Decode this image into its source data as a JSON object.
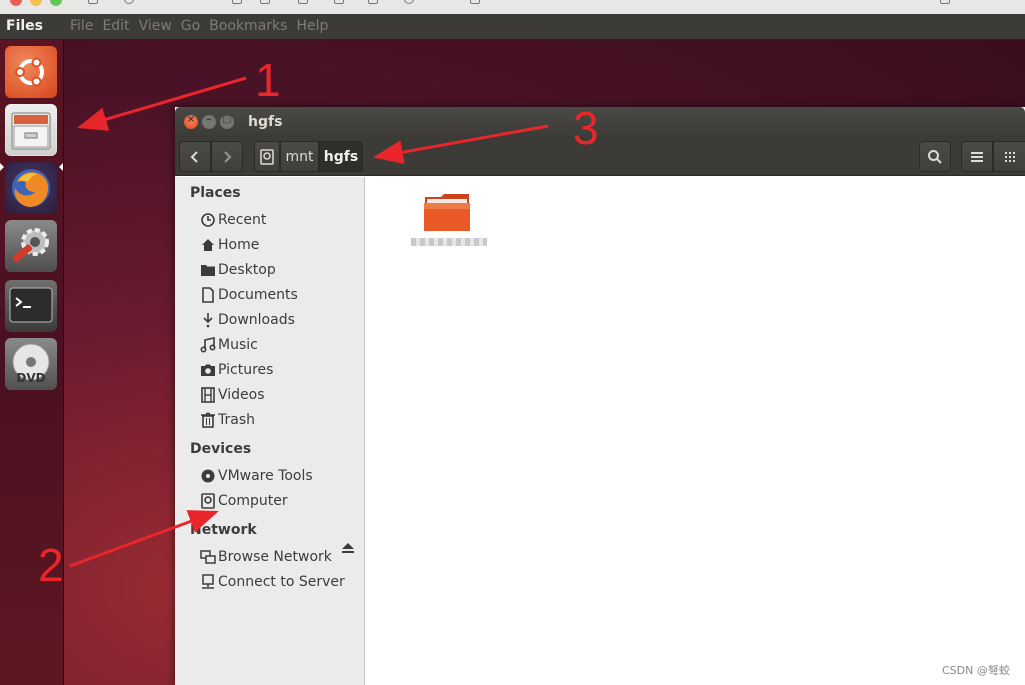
{
  "topbar": {
    "app_name": "Files",
    "menu": [
      "File",
      "Edit",
      "View",
      "Go",
      "Bookmarks",
      "Help"
    ]
  },
  "launcher": {
    "items": [
      "ubuntu-dash",
      "files",
      "firefox",
      "system-settings",
      "terminal",
      "dvd"
    ]
  },
  "window": {
    "title": "hgfs",
    "path": [
      "mnt",
      "hgfs"
    ]
  },
  "sidebar": {
    "places_heading": "Places",
    "places": [
      {
        "label": "Recent",
        "icon": "clock-icon"
      },
      {
        "label": "Home",
        "icon": "home-icon"
      },
      {
        "label": "Desktop",
        "icon": "folder-icon"
      },
      {
        "label": "Documents",
        "icon": "document-icon"
      },
      {
        "label": "Downloads",
        "icon": "download-icon"
      },
      {
        "label": "Music",
        "icon": "music-icon"
      },
      {
        "label": "Pictures",
        "icon": "camera-icon"
      },
      {
        "label": "Videos",
        "icon": "film-icon"
      },
      {
        "label": "Trash",
        "icon": "trash-icon"
      }
    ],
    "devices_heading": "Devices",
    "devices": [
      {
        "label": "VMware Tools",
        "icon": "disc-icon"
      },
      {
        "label": "Computer",
        "icon": "computer-icon"
      }
    ],
    "network_heading": "Network",
    "network": [
      {
        "label": "Browse Network",
        "icon": "network-icon"
      },
      {
        "label": "Connect to Server",
        "icon": "server-icon"
      }
    ]
  },
  "annotations": [
    "1",
    "2",
    "3"
  ],
  "watermark": "CSDN @弩蛟",
  "colors": {
    "accent": "#e95420",
    "annotation": "#e8262b",
    "panel": "#3c3b37"
  }
}
